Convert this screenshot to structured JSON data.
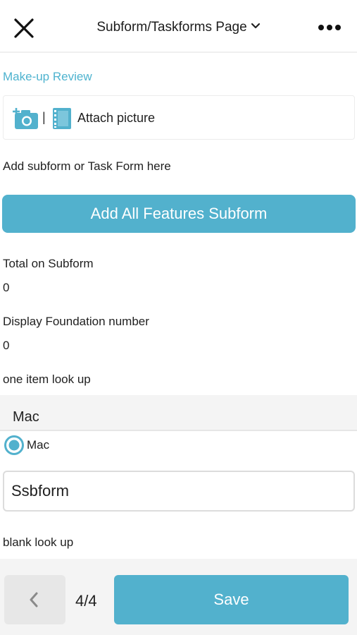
{
  "header": {
    "title": "Subform/Taskforms Page",
    "close_icon": "close-icon",
    "menu_icon": "more-horizontal-icon",
    "dropdown_icon": "chevron-down-icon"
  },
  "form": {
    "section_title": "Make-up Review",
    "attach": {
      "separator": "|",
      "label": "Attach picture",
      "camera_icon": "add-camera-icon",
      "gallery_icon": "film-gallery-icon"
    },
    "subform_hint": "Add subform or Task Form here",
    "add_button_label": "Add All Features Subform",
    "total_label": "Total on Subform",
    "total_value": "0",
    "foundation_label": "Display Foundation number",
    "foundation_value": "0",
    "lookup_label": "one item look up",
    "lookup_value": "Mac",
    "radio_option_label": "Mac",
    "text_field_value": "Ssbform",
    "blank_lookup_label": "blank look up"
  },
  "footer": {
    "page_indicator": "4/4",
    "save_label": "Save",
    "back_icon": "chevron-left-icon"
  },
  "colors": {
    "accent": "#52b1cd",
    "link": "#4eb3cf",
    "field_bg": "#f4f4f4"
  }
}
